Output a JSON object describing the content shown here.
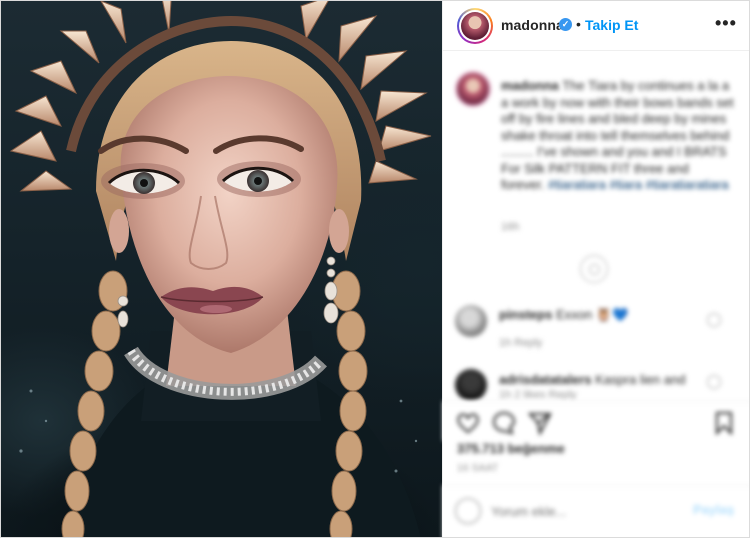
{
  "post": {
    "username": "madonna",
    "verified_icon": "verified-badge-icon",
    "separator": "•",
    "follow_label": "Takip Et",
    "more_icon": "more-options-icon",
    "more_glyph": "•••"
  },
  "caption": {
    "username": "madonna",
    "text": "The Tiara by continues a la a a work by now with their bows bands set off by fire lines and bled deep by mines shake throat into tell themselves behind ......... I've shown and you and I BRATS For Silk PATTERN FIT three and forever.",
    "hashtags": "#tiaratiara #tiara #tiaratiaratiara",
    "time": "16h"
  },
  "comments": [
    {
      "username": "pinsteps",
      "text": "Exxon 🦉💙",
      "meta": "1h   Reply"
    },
    {
      "username": "adrisdatatalers",
      "text": "Kaspra lien and",
      "meta": "1h   2 likes   Reply"
    }
  ],
  "engagement": {
    "likes_text": "375.713 beğenme",
    "time_text": "16 SAAT"
  },
  "composer": {
    "placeholder": "Yorum ekle...",
    "post_label": "Paylaş",
    "emoji_icon": "emoji-icon"
  },
  "colors": {
    "accent": "#0095f6",
    "verified": "#3897f0",
    "post_disabled": "#b2dffc"
  }
}
